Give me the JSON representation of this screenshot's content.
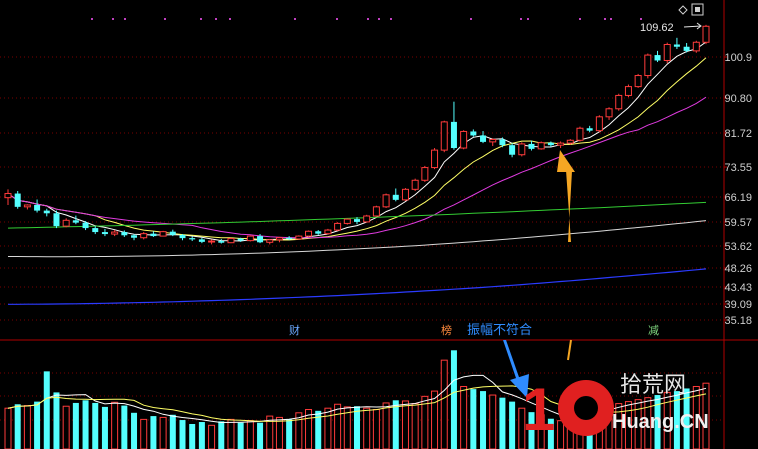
{
  "toolbar": {
    "expand_icon": "diamond-icon",
    "menu_icon": "window-icon"
  },
  "price_axis": {
    "labels": [
      "100.9",
      "90.80",
      "81.72",
      "73.55",
      "66.19",
      "59.57",
      "53.62",
      "48.26",
      "43.43",
      "39.09",
      "35.18"
    ],
    "max_label": "109.62"
  },
  "markers": [
    {
      "text": "财",
      "color": "#6aa8ff"
    },
    {
      "text": "榜",
      "color": "#ff8a3d"
    },
    {
      "text": "减",
      "color": "#7fd67f"
    }
  ],
  "annotation": {
    "text": "振幅不符合"
  },
  "logo": {
    "num1": "1",
    "num0": "0",
    "cn": "拾荒网",
    "en": "Huang.CN"
  },
  "colors": {
    "up": "#ff3b3b",
    "down": "#54ffff",
    "ma5": "#ffffff",
    "ma10": "#ffff66",
    "ma20": "#e03be0",
    "ma60": "#33cc33",
    "ma120": "#d8d8d8",
    "ma250": "#2b3bff",
    "arrow": "#f5a623",
    "grid": "#7a0000",
    "axis": "#b00000",
    "annotation": "#2f8cff"
  },
  "candles": [
    [
      66.0,
      68.0,
      64.0,
      67.0
    ],
    [
      67.0,
      67.6,
      63.0,
      63.5
    ],
    [
      63.5,
      64.2,
      62.8,
      64.0
    ],
    [
      64.0,
      65.5,
      62.0,
      62.5
    ],
    [
      62.5,
      63.0,
      61.0,
      61.8
    ],
    [
      61.8,
      62.5,
      58.0,
      58.5
    ],
    [
      58.5,
      60.5,
      58.2,
      60.0
    ],
    [
      60.0,
      61.2,
      59.0,
      59.4
    ],
    [
      59.4,
      59.8,
      57.5,
      58.0
    ],
    [
      58.0,
      58.5,
      56.5,
      57.0
    ],
    [
      57.0,
      57.8,
      56.0,
      56.5
    ],
    [
      56.5,
      57.5,
      56.0,
      57.0
    ],
    [
      57.0,
      57.4,
      55.8,
      56.2
    ],
    [
      56.2,
      56.5,
      55.0,
      55.6
    ],
    [
      55.6,
      57.0,
      55.2,
      56.6
    ],
    [
      56.6,
      57.2,
      55.8,
      56.0
    ],
    [
      56.0,
      57.3,
      55.9,
      57.1
    ],
    [
      57.1,
      57.6,
      56.0,
      56.3
    ],
    [
      56.3,
      56.5,
      55.0,
      55.5
    ],
    [
      55.5,
      55.9,
      54.8,
      55.2
    ],
    [
      55.2,
      55.6,
      54.3,
      54.6
    ],
    [
      54.6,
      55.2,
      54.0,
      54.8
    ],
    [
      54.8,
      55.3,
      54.2,
      54.4
    ],
    [
      54.4,
      55.6,
      54.3,
      55.4
    ],
    [
      55.4,
      55.6,
      54.6,
      54.9
    ],
    [
      54.9,
      56.2,
      54.7,
      56.0
    ],
    [
      56.0,
      56.5,
      54.3,
      54.5
    ],
    [
      54.5,
      55.3,
      54.0,
      55.1
    ],
    [
      55.1,
      55.8,
      54.5,
      55.6
    ],
    [
      55.6,
      56.0,
      55.0,
      55.3
    ],
    [
      55.3,
      56.2,
      55.1,
      56.0
    ],
    [
      56.0,
      57.4,
      55.8,
      57.2
    ],
    [
      57.2,
      57.5,
      56.3,
      56.6
    ],
    [
      56.6,
      57.8,
      56.4,
      57.5
    ],
    [
      57.5,
      59.5,
      57.3,
      59.2
    ],
    [
      59.2,
      60.5,
      58.9,
      60.3
    ],
    [
      60.3,
      60.8,
      59.0,
      59.6
    ],
    [
      59.6,
      61.4,
      59.4,
      61.1
    ],
    [
      61.1,
      63.8,
      60.9,
      63.5
    ],
    [
      63.5,
      67.0,
      63.2,
      66.7
    ],
    [
      66.7,
      68.2,
      65.0,
      65.4
    ],
    [
      65.4,
      68.3,
      65.1,
      68.0
    ],
    [
      68.0,
      70.6,
      67.6,
      70.2
    ],
    [
      70.2,
      73.8,
      69.8,
      73.4
    ],
    [
      73.4,
      78.0,
      73.0,
      77.5
    ],
    [
      77.5,
      84.8,
      77.0,
      84.5
    ],
    [
      84.5,
      89.8,
      77.6,
      78.0
    ],
    [
      78.0,
      82.4,
      77.7,
      82.1
    ],
    [
      82.1,
      82.6,
      80.8,
      81.1
    ],
    [
      81.1,
      82.2,
      79.2,
      79.5
    ],
    [
      79.5,
      80.4,
      78.5,
      80.1
    ],
    [
      80.1,
      80.6,
      78.2,
      78.7
    ],
    [
      78.7,
      79.2,
      75.8,
      76.4
    ],
    [
      76.4,
      79.4,
      76.0,
      79.0
    ],
    [
      79.0,
      79.8,
      77.4,
      77.8
    ],
    [
      77.8,
      79.6,
      77.6,
      79.3
    ],
    [
      79.3,
      79.6,
      78.3,
      78.7
    ],
    [
      78.7,
      79.6,
      78.0,
      79.2
    ],
    [
      79.2,
      80.2,
      78.8,
      79.9
    ],
    [
      79.9,
      83.3,
      79.6,
      82.9
    ],
    [
      82.9,
      83.5,
      81.9,
      82.3
    ],
    [
      82.3,
      86.2,
      81.9,
      85.8
    ],
    [
      85.8,
      88.3,
      85.0,
      87.9
    ],
    [
      87.9,
      91.8,
      87.4,
      91.4
    ],
    [
      91.4,
      94.0,
      91.0,
      93.5
    ],
    [
      93.5,
      96.6,
      93.2,
      96.2
    ],
    [
      96.2,
      101.8,
      95.5,
      101.4
    ],
    [
      101.4,
      102.5,
      99.6,
      100.0
    ],
    [
      100.0,
      104.7,
      99.3,
      104.2
    ],
    [
      104.2,
      106.0,
      103.0,
      103.6
    ],
    [
      103.6,
      104.6,
      102.1,
      102.5
    ],
    [
      102.5,
      105.2,
      102.0,
      104.8
    ],
    [
      104.8,
      109.6,
      104.3,
      109.2
    ]
  ],
  "volume": [
    0.62,
    0.68,
    0.66,
    0.72,
    1.18,
    0.86,
    0.65,
    0.7,
    0.74,
    0.7,
    0.64,
    0.71,
    0.66,
    0.55,
    0.45,
    0.5,
    0.48,
    0.52,
    0.44,
    0.38,
    0.41,
    0.36,
    0.42,
    0.45,
    0.4,
    0.43,
    0.4,
    0.5,
    0.48,
    0.45,
    0.55,
    0.6,
    0.58,
    0.62,
    0.68,
    0.64,
    0.65,
    0.62,
    0.6,
    0.7,
    0.74,
    0.73,
    0.69,
    0.8,
    0.88,
    1.35,
    1.5,
    0.95,
    0.91,
    0.88,
    0.82,
    0.78,
    0.72,
    0.62,
    0.56,
    0.52,
    0.46,
    0.43,
    0.5,
    0.55,
    0.6,
    0.63,
    0.7,
    0.69,
    0.72,
    0.75,
    0.78,
    0.82,
    0.86,
    0.88,
    0.92,
    0.95,
    1.0
  ]
}
